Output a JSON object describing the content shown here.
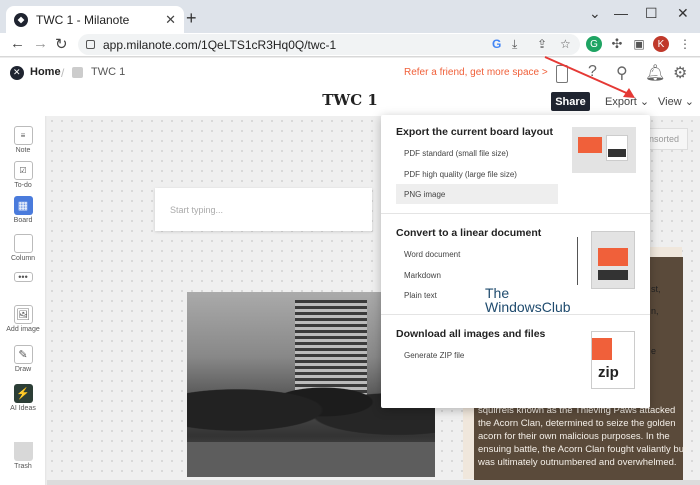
{
  "browser": {
    "tab_title": "TWC 1 - Milanote",
    "tab_close": "✕",
    "new_tab": "+",
    "window_controls": [
      "⌄",
      "—",
      "☐",
      "✕"
    ],
    "url": "app.milanote.com/1QeLTS1cR3Hq0Q/twc-1",
    "profile_initial": "K",
    "profile_color": "#c0392b",
    "ext_initial": "G"
  },
  "app": {
    "home_label": "Home",
    "breadcrumb_board": "TWC 1",
    "refer_text": "Refer a friend, get more space >",
    "board_title": "TWC 1",
    "share_label": "Share",
    "export_label": "Export",
    "view_label": "View",
    "accent": "#f0603a"
  },
  "sidebar": {
    "tools": [
      {
        "label": "Note",
        "icon": "note-icon"
      },
      {
        "label": "To-do",
        "icon": "todo-icon"
      },
      {
        "label": "Board",
        "icon": "board-icon"
      },
      {
        "label": "Column",
        "icon": "column-icon"
      },
      {
        "label": "",
        "icon": "more-icon"
      },
      {
        "label": "Add image",
        "icon": "image-icon"
      },
      {
        "label": "Draw",
        "icon": "pencil-icon"
      },
      {
        "label": "AI Ideas",
        "icon": "ai-icon"
      },
      {
        "label": "Trash",
        "icon": "trash-icon"
      }
    ]
  },
  "canvas": {
    "note_placeholder": "Start typing...",
    "unsorted_label": "nsorted",
    "story_fragments": [
      "st,",
      "n,",
      "e"
    ],
    "story_text": "squirrels known as the Thieving Paws attacked the Acorn Clan, determined to seize the golden acorn for their own malicious purposes. In the ensuing battle, the Acorn Clan fought valiantly but was ultimately outnumbered and overwhelmed.",
    "watermark_line1": "The",
    "watermark_line2": "WindowsClub"
  },
  "export_menu": {
    "section1": {
      "heading": "Export the current board layout",
      "items": [
        "PDF standard (small file size)",
        "PDF high quality (large file size)",
        "PNG image"
      ]
    },
    "section2": {
      "heading": "Convert to a linear document",
      "items": [
        "Word document",
        "Markdown",
        "Plain text"
      ]
    },
    "section3": {
      "heading": "Download all images and files",
      "items": [
        "Generate ZIP file"
      ],
      "zip_label": "zip"
    }
  }
}
